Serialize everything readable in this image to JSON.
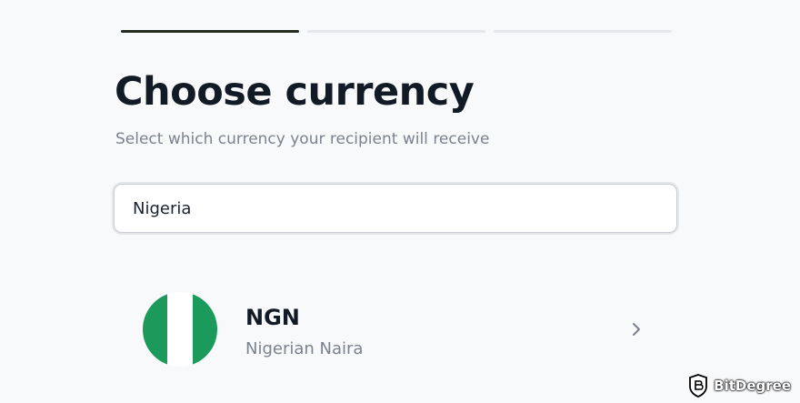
{
  "progress": {
    "steps": [
      {
        "label": "",
        "active": true
      },
      {
        "label": "",
        "active": false
      },
      {
        "label": "",
        "active": false
      }
    ]
  },
  "header": {
    "title": "Choose currency",
    "subtitle": "Select which currency your recipient will receive"
  },
  "search": {
    "value": "Nigeria"
  },
  "results": [
    {
      "code": "NGN",
      "name": "Nigerian Naira",
      "flag_icon": "nigeria-flag-icon",
      "chevron_icon": "chevron-right-icon"
    }
  ],
  "watermark": {
    "text": "BitDegree",
    "logo_icon": "bitdegree-logo-icon"
  },
  "colors": {
    "background": "#f8f9fb",
    "title": "#121a26",
    "muted": "#7b828e",
    "progress_active": "#222a1e",
    "progress_inactive": "#e5e7eb",
    "flag_green": "#1c9a5c"
  }
}
